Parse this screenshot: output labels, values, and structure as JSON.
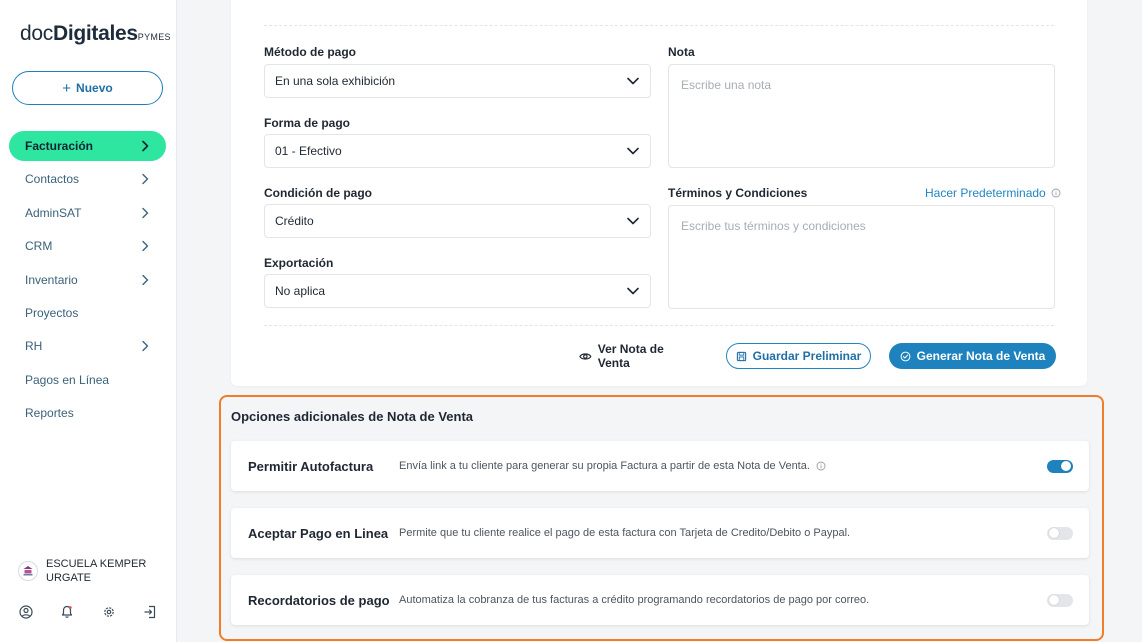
{
  "brand": {
    "doc": "doc",
    "digitales": "Digitales",
    "pymes": "PYMES"
  },
  "sidebar": {
    "new_button": {
      "plus": "+",
      "label": "Nuevo"
    },
    "items": [
      {
        "label": "Facturación",
        "chevron": true,
        "active": true
      },
      {
        "label": "Contactos",
        "chevron": true
      },
      {
        "label": "AdminSAT",
        "chevron": true
      },
      {
        "label": "CRM",
        "chevron": true
      },
      {
        "label": "Inventario",
        "chevron": true
      },
      {
        "label": "Proyectos",
        "chevron": false
      },
      {
        "label": "RH",
        "chevron": true
      },
      {
        "label": "Pagos en Línea",
        "chevron": false
      },
      {
        "label": "Reportes",
        "chevron": false
      }
    ],
    "user_name": "ESCUELA KEMPER URGATE",
    "bottom_icons": [
      "user-circle-icon",
      "bell-icon",
      "gear-icon",
      "logout-icon"
    ]
  },
  "form": {
    "metodo_pago": {
      "label": "Método de pago",
      "value": "En una sola exhibición"
    },
    "forma_pago": {
      "label": "Forma de pago",
      "value": "01 - Efectivo"
    },
    "condicion_pago": {
      "label": "Condición de pago",
      "value": "Crédito"
    },
    "exportacion": {
      "label": "Exportación",
      "value": "No aplica"
    },
    "nota": {
      "label": "Nota",
      "placeholder": "Escribe una nota"
    },
    "terminos": {
      "label": "Términos y Condiciones",
      "placeholder": "Escribe tus términos y condiciones",
      "default_link": "Hacer Predeterminado"
    }
  },
  "actions": {
    "view": "Ver Nota de Venta",
    "save": "Guardar Preliminar",
    "generate": "Generar Nota de Venta"
  },
  "options": {
    "title": "Opciones adicionales de Nota de Venta",
    "items": [
      {
        "title": "Permitir Autofactura",
        "desc": "Envía link a tu cliente para generar su propia Factura a partir de esta Nota de Venta.",
        "info": true,
        "enabled": true
      },
      {
        "title": "Aceptar Pago en Linea",
        "desc": "Permite que tu cliente realice el pago de esta factura con Tarjeta de Credito/Debito o Paypal.",
        "info": false,
        "enabled": false
      },
      {
        "title": "Recordatorios de pago",
        "desc": "Automatiza la cobranza de tus facturas a crédito programando recordatorios de pago por correo.",
        "info": false,
        "enabled": false
      }
    ]
  },
  "colors": {
    "accent": "#1d82bd",
    "active_nav": "#2fe6a1",
    "highlight_border": "#f07d2a"
  }
}
